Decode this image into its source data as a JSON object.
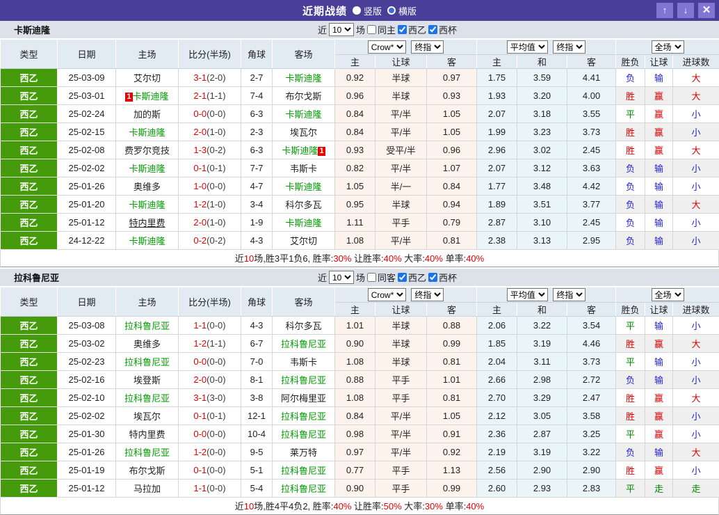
{
  "titlebar": {
    "title": "近期战绩",
    "radio_vertical": "竖版",
    "radio_horizontal": "横版",
    "up_icon": "↑",
    "down_icon": "↓",
    "close_icon": "✕"
  },
  "colors": {
    "accent_purple": "#4b3e99",
    "button_purple": "#8375d4",
    "subject_team_green": "#009900",
    "type_badge_green": "#459b0b",
    "score_red": "#e60000",
    "result_red": "#d60000",
    "result_blue": "#2323cc",
    "result_green": "#008800"
  },
  "table_header": {
    "main": [
      "类型",
      "日期",
      "主场",
      "比分(半场)",
      "角球",
      "客场"
    ],
    "odds_select_company": "Crow*",
    "odds_select_stage": "终指",
    "avg_select_company": "平均值",
    "avg_select_stage": "终指",
    "scope_select": "全场",
    "sub": [
      "主",
      "让球",
      "客",
      "主",
      "和",
      "客",
      "胜负",
      "让球",
      "进球数"
    ]
  },
  "sections": [
    {
      "team": "卡斯迪隆",
      "controls": {
        "near": "近",
        "count": "10",
        "matches": "场",
        "same_side": "同主",
        "league1": "西乙",
        "league2": "西杯"
      },
      "rows": [
        {
          "type": "西乙",
          "date": "25-03-09",
          "home": "艾尔切",
          "home_subject": false,
          "score": "3-1",
          "half": "(2-0)",
          "corner": "2-7",
          "away": "卡斯迪隆",
          "away_subject": true,
          "odds": [
            "0.92",
            "半球",
            "0.97"
          ],
          "avg": [
            "1.75",
            "3.59",
            "4.41"
          ],
          "results": [
            "负",
            "输",
            "大"
          ],
          "result_colors": [
            "blue",
            "blue",
            "red"
          ]
        },
        {
          "type": "西乙",
          "date": "25-03-01",
          "home": "卡斯迪隆",
          "home_subject": true,
          "home_badge": "1",
          "score": "2-1",
          "half": "(1-1)",
          "corner": "7-4",
          "away": "布尔戈斯",
          "away_subject": false,
          "odds": [
            "0.96",
            "半球",
            "0.93"
          ],
          "avg": [
            "1.93",
            "3.20",
            "4.00"
          ],
          "results": [
            "胜",
            "赢",
            "大"
          ],
          "result_colors": [
            "red",
            "red",
            "red"
          ]
        },
        {
          "type": "西乙",
          "date": "25-02-24",
          "home": "加的斯",
          "home_subject": false,
          "score": "0-0",
          "half": "(0-0)",
          "corner": "6-3",
          "away": "卡斯迪隆",
          "away_subject": true,
          "odds": [
            "0.84",
            "平/半",
            "1.05"
          ],
          "avg": [
            "2.07",
            "3.18",
            "3.55"
          ],
          "results": [
            "平",
            "赢",
            "小"
          ],
          "result_colors": [
            "green",
            "red",
            "blue"
          ]
        },
        {
          "type": "西乙",
          "date": "25-02-15",
          "home": "卡斯迪隆",
          "home_subject": true,
          "score": "2-0",
          "half": "(1-0)",
          "corner": "2-3",
          "away": "埃瓦尔",
          "away_subject": false,
          "odds": [
            "0.84",
            "平/半",
            "1.05"
          ],
          "avg": [
            "1.99",
            "3.23",
            "3.73"
          ],
          "results": [
            "胜",
            "赢",
            "小"
          ],
          "result_colors": [
            "red",
            "red",
            "blue"
          ]
        },
        {
          "type": "西乙",
          "date": "25-02-08",
          "home": "费罗尔竞技",
          "home_subject": false,
          "score": "1-3",
          "half": "(0-2)",
          "corner": "6-3",
          "away": "卡斯迪隆",
          "away_subject": true,
          "away_badge": "1",
          "odds": [
            "0.93",
            "受平/半",
            "0.96"
          ],
          "avg": [
            "2.96",
            "3.02",
            "2.45"
          ],
          "results": [
            "胜",
            "赢",
            "大"
          ],
          "result_colors": [
            "red",
            "red",
            "red"
          ]
        },
        {
          "type": "西乙",
          "date": "25-02-02",
          "home": "卡斯迪隆",
          "home_subject": true,
          "score": "0-1",
          "half": "(0-1)",
          "corner": "7-7",
          "away": "韦斯卡",
          "away_subject": false,
          "odds": [
            "0.82",
            "平/半",
            "1.07"
          ],
          "avg": [
            "2.07",
            "3.12",
            "3.63"
          ],
          "results": [
            "负",
            "输",
            "小"
          ],
          "result_colors": [
            "blue",
            "blue",
            "blue"
          ]
        },
        {
          "type": "西乙",
          "date": "25-01-26",
          "home": "奥维多",
          "home_subject": false,
          "score": "1-0",
          "half": "(0-0)",
          "corner": "4-7",
          "away": "卡斯迪隆",
          "away_subject": true,
          "odds": [
            "1.05",
            "半/一",
            "0.84"
          ],
          "avg": [
            "1.77",
            "3.48",
            "4.42"
          ],
          "results": [
            "负",
            "输",
            "小"
          ],
          "result_colors": [
            "blue",
            "blue",
            "blue"
          ]
        },
        {
          "type": "西乙",
          "date": "25-01-20",
          "home": "卡斯迪隆",
          "home_subject": true,
          "score": "1-2",
          "half": "(1-0)",
          "corner": "3-4",
          "away": "科尔多瓦",
          "away_subject": false,
          "odds": [
            "0.95",
            "半球",
            "0.94"
          ],
          "avg": [
            "1.89",
            "3.51",
            "3.77"
          ],
          "results": [
            "负",
            "输",
            "大"
          ],
          "result_colors": [
            "blue",
            "blue",
            "red"
          ]
        },
        {
          "type": "西乙",
          "date": "25-01-12",
          "home": "特内里费",
          "home_subject": false,
          "home_underline": true,
          "score": "2-0",
          "half": "(1-0)",
          "corner": "1-9",
          "away": "卡斯迪隆",
          "away_subject": true,
          "odds": [
            "1.11",
            "平手",
            "0.79"
          ],
          "avg": [
            "2.87",
            "3.10",
            "2.45"
          ],
          "results": [
            "负",
            "输",
            "小"
          ],
          "result_colors": [
            "blue",
            "blue",
            "blue"
          ]
        },
        {
          "type": "西乙",
          "date": "24-12-22",
          "home": "卡斯迪隆",
          "home_subject": true,
          "score": "0-2",
          "half": "(0-2)",
          "corner": "4-3",
          "away": "艾尔切",
          "away_subject": false,
          "odds": [
            "1.08",
            "平/半",
            "0.81"
          ],
          "avg": [
            "2.38",
            "3.13",
            "2.95"
          ],
          "results": [
            "负",
            "输",
            "小"
          ],
          "result_colors": [
            "blue",
            "blue",
            "blue"
          ]
        }
      ],
      "summary": [
        {
          "t": "近",
          "red": false
        },
        {
          "t": "10",
          "red": true
        },
        {
          "t": "场,胜3平1负6, 胜率:",
          "red": false
        },
        {
          "t": "30%",
          "red": true
        },
        {
          "t": " 让胜率:",
          "red": false
        },
        {
          "t": "40%",
          "red": true
        },
        {
          "t": " 大率:",
          "red": false
        },
        {
          "t": "40%",
          "red": true
        },
        {
          "t": " 单率:",
          "red": false
        },
        {
          "t": "40%",
          "red": true
        }
      ]
    },
    {
      "team": "拉科鲁尼亚",
      "controls": {
        "near": "近",
        "count": "10",
        "matches": "场",
        "same_side": "同客",
        "league1": "西乙",
        "league2": "西杯"
      },
      "rows": [
        {
          "type": "西乙",
          "date": "25-03-08",
          "home": "拉科鲁尼亚",
          "home_subject": true,
          "score": "1-1",
          "half": "(0-0)",
          "corner": "4-3",
          "away": "科尔多瓦",
          "away_subject": false,
          "odds": [
            "1.01",
            "半球",
            "0.88"
          ],
          "avg": [
            "2.06",
            "3.22",
            "3.54"
          ],
          "results": [
            "平",
            "输",
            "小"
          ],
          "result_colors": [
            "green",
            "blue",
            "blue"
          ]
        },
        {
          "type": "西乙",
          "date": "25-03-02",
          "home": "奥维多",
          "home_subject": false,
          "score": "1-2",
          "half": "(1-1)",
          "corner": "6-7",
          "away": "拉科鲁尼亚",
          "away_subject": true,
          "odds": [
            "0.90",
            "半球",
            "0.99"
          ],
          "avg": [
            "1.85",
            "3.19",
            "4.46"
          ],
          "results": [
            "胜",
            "赢",
            "大"
          ],
          "result_colors": [
            "red",
            "red",
            "red"
          ]
        },
        {
          "type": "西乙",
          "date": "25-02-23",
          "home": "拉科鲁尼亚",
          "home_subject": true,
          "score": "0-0",
          "half": "(0-0)",
          "corner": "7-0",
          "away": "韦斯卡",
          "away_subject": false,
          "odds": [
            "1.08",
            "半球",
            "0.81"
          ],
          "avg": [
            "2.04",
            "3.11",
            "3.73"
          ],
          "results": [
            "平",
            "输",
            "小"
          ],
          "result_colors": [
            "green",
            "blue",
            "blue"
          ]
        },
        {
          "type": "西乙",
          "date": "25-02-16",
          "home": "埃登斯",
          "home_subject": false,
          "score": "2-0",
          "half": "(0-0)",
          "corner": "8-1",
          "away": "拉科鲁尼亚",
          "away_subject": true,
          "odds": [
            "0.88",
            "平手",
            "1.01"
          ],
          "avg": [
            "2.66",
            "2.98",
            "2.72"
          ],
          "results": [
            "负",
            "输",
            "小"
          ],
          "result_colors": [
            "blue",
            "blue",
            "blue"
          ]
        },
        {
          "type": "西乙",
          "date": "25-02-10",
          "home": "拉科鲁尼亚",
          "home_subject": true,
          "score": "3-1",
          "half": "(3-0)",
          "corner": "3-8",
          "away": "阿尔梅里亚",
          "away_subject": false,
          "odds": [
            "1.08",
            "平手",
            "0.81"
          ],
          "avg": [
            "2.70",
            "3.29",
            "2.47"
          ],
          "results": [
            "胜",
            "赢",
            "大"
          ],
          "result_colors": [
            "red",
            "red",
            "red"
          ]
        },
        {
          "type": "西乙",
          "date": "25-02-02",
          "home": "埃瓦尔",
          "home_subject": false,
          "score": "0-1",
          "half": "(0-1)",
          "corner": "12-1",
          "away": "拉科鲁尼亚",
          "away_subject": true,
          "odds": [
            "0.84",
            "平/半",
            "1.05"
          ],
          "avg": [
            "2.12",
            "3.05",
            "3.58"
          ],
          "results": [
            "胜",
            "赢",
            "小"
          ],
          "result_colors": [
            "red",
            "red",
            "blue"
          ]
        },
        {
          "type": "西乙",
          "date": "25-01-30",
          "home": "特内里费",
          "home_subject": false,
          "score": "0-0",
          "half": "(0-0)",
          "corner": "10-4",
          "away": "拉科鲁尼亚",
          "away_subject": true,
          "odds": [
            "0.98",
            "平/半",
            "0.91"
          ],
          "avg": [
            "2.36",
            "2.87",
            "3.25"
          ],
          "results": [
            "平",
            "赢",
            "小"
          ],
          "result_colors": [
            "green",
            "red",
            "blue"
          ]
        },
        {
          "type": "西乙",
          "date": "25-01-26",
          "home": "拉科鲁尼亚",
          "home_subject": true,
          "score": "1-2",
          "half": "(0-0)",
          "corner": "9-5",
          "away": "莱万特",
          "away_subject": false,
          "odds": [
            "0.97",
            "平/半",
            "0.92"
          ],
          "avg": [
            "2.19",
            "3.19",
            "3.22"
          ],
          "results": [
            "负",
            "输",
            "大"
          ],
          "result_colors": [
            "blue",
            "blue",
            "red"
          ]
        },
        {
          "type": "西乙",
          "date": "25-01-19",
          "home": "布尔戈斯",
          "home_subject": false,
          "score": "0-1",
          "half": "(0-0)",
          "corner": "5-1",
          "away": "拉科鲁尼亚",
          "away_subject": true,
          "odds": [
            "0.77",
            "平手",
            "1.13"
          ],
          "avg": [
            "2.56",
            "2.90",
            "2.90"
          ],
          "results": [
            "胜",
            "赢",
            "小"
          ],
          "result_colors": [
            "red",
            "red",
            "blue"
          ]
        },
        {
          "type": "西乙",
          "date": "25-01-12",
          "home": "马拉加",
          "home_subject": false,
          "score": "1-1",
          "half": "(0-0)",
          "corner": "5-4",
          "away": "拉科鲁尼亚",
          "away_subject": true,
          "odds": [
            "0.90",
            "平手",
            "0.99"
          ],
          "avg": [
            "2.60",
            "2.93",
            "2.83"
          ],
          "results": [
            "平",
            "走",
            "走"
          ],
          "result_colors": [
            "green",
            "green",
            "green"
          ]
        }
      ],
      "summary": [
        {
          "t": "近",
          "red": false
        },
        {
          "t": "10",
          "red": true
        },
        {
          "t": "场,胜4平4负2, 胜率:",
          "red": false
        },
        {
          "t": "40%",
          "red": true
        },
        {
          "t": " 让胜率:",
          "red": false
        },
        {
          "t": "50%",
          "red": true
        },
        {
          "t": " 大率:",
          "red": false
        },
        {
          "t": "30%",
          "red": true
        },
        {
          "t": " 单率:",
          "red": false
        },
        {
          "t": "40%",
          "red": true
        }
      ]
    }
  ]
}
